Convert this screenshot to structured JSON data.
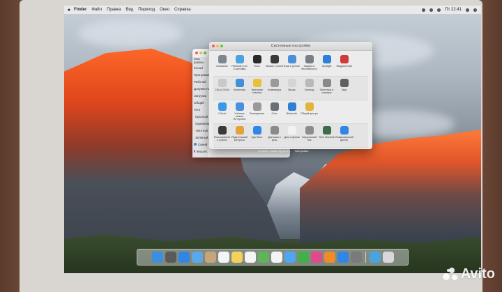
{
  "menubar": {
    "apple_icon": "apple-icon",
    "items": [
      "Finder",
      "Файл",
      "Правка",
      "Вид",
      "Переход",
      "Окно",
      "Справка"
    ],
    "clock": "Пт 22:41"
  },
  "finder": {
    "sidebar_items": [
      "Мои файлы",
      "iCloud",
      "Программы",
      "Рабочий",
      "Документы",
      "Загрузки",
      "Общий",
      "Теги",
      "Красный",
      "Оранжевый",
      "Жёлтый",
      "Зелёный",
      "Синий",
      "Фиолет."
    ],
    "tag_colors": [
      "#e8463c",
      "#f0992f",
      "#f1d33b",
      "#4fb84a",
      "#3d86e6",
      "#a35bd1"
    ]
  },
  "prefs": {
    "title": "Системные настройки",
    "rows": [
      [
        {
          "label": "Основные",
          "icon": "general-icon",
          "color": "#7d8690"
        },
        {
          "label": "Рабочий стол и заставка",
          "icon": "desktop-icon",
          "color": "#4aa3e0"
        },
        {
          "label": "Dock",
          "icon": "dock-icon",
          "color": "#2a2a2a"
        },
        {
          "label": "Mission Control",
          "icon": "mission-control-icon",
          "color": "#3a3a3a"
        },
        {
          "label": "Язык и регион",
          "icon": "language-icon",
          "color": "#4a8fd8"
        },
        {
          "label": "Защита и безопасность",
          "icon": "security-icon",
          "color": "#7a7f86"
        },
        {
          "label": "Spotlight",
          "icon": "spotlight-icon",
          "color": "#2d7fd8"
        },
        {
          "label": "Уведомления",
          "icon": "notifications-icon",
          "color": "#d03a3a"
        }
      ],
      [
        {
          "label": "CDs & DVDs",
          "icon": "cd-icon",
          "color": "#c9c9c9"
        },
        {
          "label": "Мониторы",
          "icon": "displays-icon",
          "color": "#3f8fd9"
        },
        {
          "label": "Экономия энергии",
          "icon": "energy-icon",
          "color": "#e6c23c"
        },
        {
          "label": "Клавиатура",
          "icon": "keyboard-icon",
          "color": "#9a9a9a"
        },
        {
          "label": "Мышь",
          "icon": "mouse-icon",
          "color": "#d5d5d5"
        },
        {
          "label": "Трекпад",
          "icon": "trackpad-icon",
          "color": "#b9b9b9"
        },
        {
          "label": "Принтеры и сканеры",
          "icon": "printer-icon",
          "color": "#8a8a8a"
        },
        {
          "label": "Звук",
          "icon": "sound-icon",
          "color": "#5f5f5f"
        }
      ],
      [
        {
          "label": "iCloud",
          "icon": "icloud-icon",
          "color": "#3b97e8"
        },
        {
          "label": "Учётные записи Интернета",
          "icon": "internet-accounts-icon",
          "color": "#4c8fe0"
        },
        {
          "label": "Расширения",
          "icon": "extensions-icon",
          "color": "#9a9a9a"
        },
        {
          "label": "Сеть",
          "icon": "network-icon",
          "color": "#6a6f76"
        },
        {
          "label": "Bluetooth",
          "icon": "bluetooth-icon",
          "color": "#2f7fd6"
        },
        {
          "label": "Общий доступ",
          "icon": "sharing-icon",
          "color": "#e1b63a"
        }
      ],
      [
        {
          "label": "Пользователи и группы",
          "icon": "users-icon",
          "color": "#3a3a3a"
        },
        {
          "label": "Родительский контроль",
          "icon": "parental-icon",
          "color": "#e6a13a"
        },
        {
          "label": "App Store",
          "icon": "app-store-icon",
          "color": "#2f86e6"
        },
        {
          "label": "Диктовка и речь",
          "icon": "dictation-icon",
          "color": "#8a8a8a"
        },
        {
          "label": "Дата и время",
          "icon": "date-time-icon",
          "color": "#f2f2f2"
        },
        {
          "label": "Загрузочный том",
          "icon": "startup-disk-icon",
          "color": "#8d8d8d"
        },
        {
          "label": "Time Machine",
          "icon": "time-machine-icon",
          "color": "#3a6e4a"
        },
        {
          "label": "Универсальный доступ",
          "icon": "accessibility-icon",
          "color": "#2f86e6"
        }
      ]
    ]
  },
  "below_text": {
    "line1": "Открыть новый Apple ID...",
    "line2": "Настройки"
  },
  "dock": {
    "items": [
      {
        "name": "finder-icon",
        "color": "#3a8fe0"
      },
      {
        "name": "launchpad-icon",
        "color": "#5a5a5a"
      },
      {
        "name": "safari-icon",
        "color": "#2f86e6"
      },
      {
        "name": "mail-icon",
        "color": "#5aa8e8"
      },
      {
        "name": "contacts-icon",
        "color": "#c9a47a"
      },
      {
        "name": "calendar-icon",
        "color": "#f4f4f4"
      },
      {
        "name": "notes-icon",
        "color": "#f3d15a"
      },
      {
        "name": "reminders-icon",
        "color": "#f4f4f4"
      },
      {
        "name": "maps-icon",
        "color": "#5fb35a"
      },
      {
        "name": "photos-icon",
        "color": "#f4f4f4"
      },
      {
        "name": "messages-icon",
        "color": "#4ea7f0"
      },
      {
        "name": "facetime-icon",
        "color": "#3fb04a"
      },
      {
        "name": "itunes-icon",
        "color": "#e04a8a"
      },
      {
        "name": "ibooks-icon",
        "color": "#f08a2a"
      },
      {
        "name": "app-store-icon",
        "color": "#2f86e6"
      },
      {
        "name": "system-preferences-icon",
        "color": "#7a7a7a"
      }
    ],
    "right_items": [
      {
        "name": "downloads-folder-icon",
        "color": "#4aa3e0"
      },
      {
        "name": "trash-icon",
        "color": "#d8d8d8"
      }
    ]
  },
  "watermark": {
    "text": "Avito"
  }
}
